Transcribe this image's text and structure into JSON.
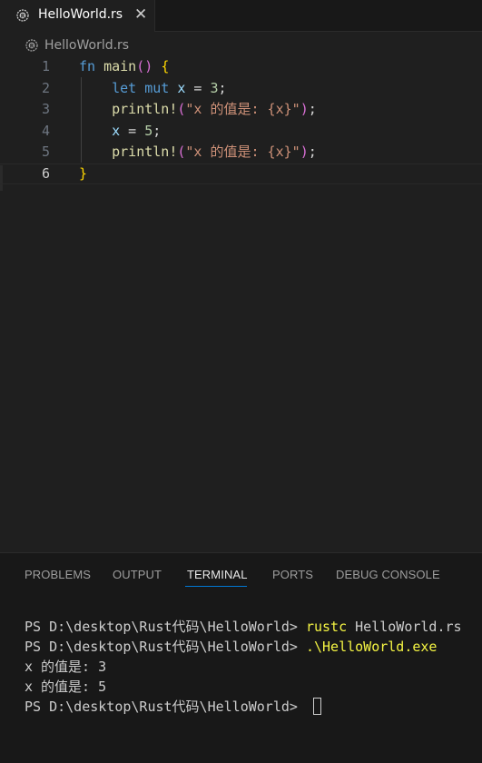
{
  "tab": {
    "label": "HelloWorld.rs",
    "close_glyph": "✕",
    "icon": "rust-file-icon"
  },
  "breadcrumb": {
    "label": "HelloWorld.rs",
    "icon": "rust-file-icon"
  },
  "editor": {
    "active_line": 6,
    "lines": [
      {
        "number": "1",
        "tokens": [
          [
            "fn",
            "k-blue"
          ],
          [
            " ",
            "k-plain"
          ],
          [
            "main",
            "k-fn"
          ],
          [
            "()",
            "k-paren"
          ],
          [
            " ",
            "k-plain"
          ],
          [
            "{",
            "k-brace"
          ]
        ]
      },
      {
        "number": "2",
        "tokens": [
          [
            "    ",
            "k-plain"
          ],
          [
            "let",
            "k-blue"
          ],
          [
            " ",
            "k-plain"
          ],
          [
            "mut",
            "k-blue"
          ],
          [
            " ",
            "k-plain"
          ],
          [
            "x",
            "k-var"
          ],
          [
            " = ",
            "k-plain"
          ],
          [
            "3",
            "k-num"
          ],
          [
            ";",
            "k-plain"
          ]
        ]
      },
      {
        "number": "3",
        "tokens": [
          [
            "    ",
            "k-plain"
          ],
          [
            "println!",
            "k-fn"
          ],
          [
            "(",
            "k-paren"
          ],
          [
            "\"x 的值是: {x}\"",
            "k-str"
          ],
          [
            ")",
            "k-paren"
          ],
          [
            ";",
            "k-plain"
          ]
        ]
      },
      {
        "number": "4",
        "tokens": [
          [
            "    ",
            "k-plain"
          ],
          [
            "x",
            "k-var"
          ],
          [
            " = ",
            "k-plain"
          ],
          [
            "5",
            "k-num"
          ],
          [
            ";",
            "k-plain"
          ]
        ]
      },
      {
        "number": "5",
        "tokens": [
          [
            "    ",
            "k-plain"
          ],
          [
            "println!",
            "k-fn"
          ],
          [
            "(",
            "k-paren"
          ],
          [
            "\"x 的值是: {x}\"",
            "k-str"
          ],
          [
            ")",
            "k-paren"
          ],
          [
            ";",
            "k-plain"
          ]
        ]
      },
      {
        "number": "6",
        "tokens": [
          [
            "}",
            "k-brace"
          ]
        ]
      }
    ]
  },
  "panel": {
    "tabs": [
      "PROBLEMS",
      "OUTPUT",
      "TERMINAL",
      "PORTS",
      "DEBUG CONSOLE"
    ],
    "active_tab": "TERMINAL"
  },
  "terminal": {
    "lines": [
      {
        "prompt": "PS D:\\desktop\\Rust代码\\HelloWorld> ",
        "cmd": "rustc",
        "arg": " HelloWorld.rs"
      },
      {
        "prompt": "PS D:\\desktop\\Rust代码\\HelloWorld> ",
        "cmd": ".\\HelloWorld.exe",
        "arg": ""
      },
      {
        "text": "x 的值是: 3"
      },
      {
        "text": "x 的值是: 5"
      },
      {
        "prompt": "PS D:\\desktop\\Rust代码\\HelloWorld> ",
        "cursor": true
      }
    ]
  },
  "colors": {
    "editor_bg": "#1f1f1f",
    "panel_bg": "#181818",
    "accent": "#0078d4",
    "command_yellow": "#f5f543"
  }
}
